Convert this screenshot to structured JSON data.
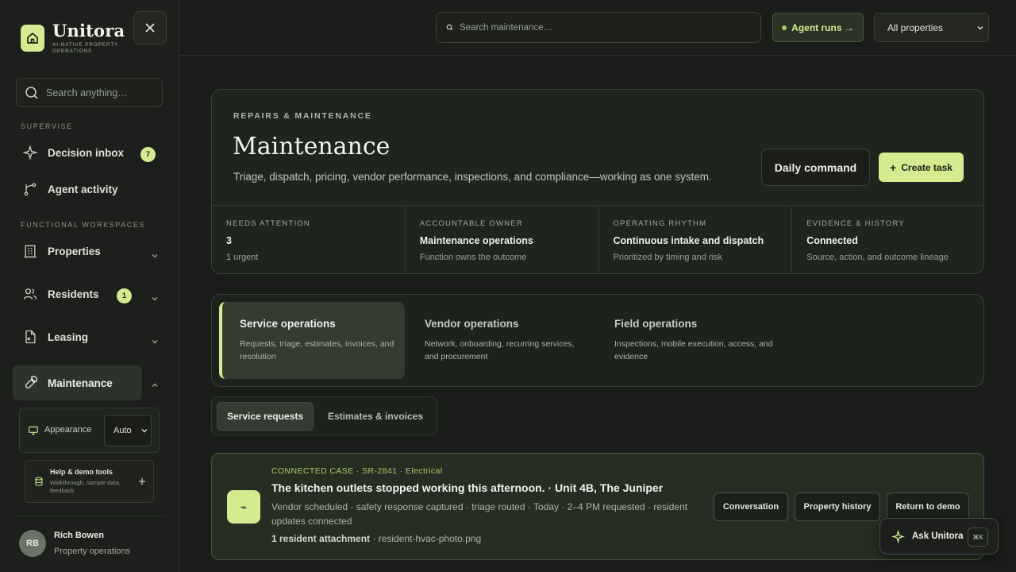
{
  "brand": {
    "name": "Unitora",
    "tagline": "AI-NATIVE PROPERTY OPERATIONS"
  },
  "sidebar": {
    "search_placeholder": "Search anything…",
    "section_supervise": "SUPERVISE",
    "section_workspaces": "FUNCTIONAL WORKSPACES",
    "items": [
      {
        "label": "Decision inbox",
        "badge": "7"
      },
      {
        "label": "Agent activity"
      },
      {
        "label": "Properties"
      },
      {
        "label": "Residents",
        "badge": "1"
      },
      {
        "label": "Leasing"
      },
      {
        "label": "Maintenance"
      }
    ],
    "appearance": {
      "label": "Appearance",
      "value": "Auto"
    },
    "help": {
      "title": "Help & demo tools",
      "subtitle": "Walkthrough, sample data, feedback"
    },
    "user": {
      "initials": "RB",
      "name": "Rich Bowen",
      "role": "Property operations"
    }
  },
  "topbar": {
    "search_placeholder": "Search maintenance…",
    "agent_runs": "Agent runs →",
    "property_filter": "All properties"
  },
  "hero": {
    "eyebrow": "REPAIRS & MAINTENANCE",
    "title": "Maintenance",
    "description": "Triage, dispatch, pricing, vendor performance, inspections, and compliance—working as one system.",
    "daily_command": "Daily command",
    "create_task": "Create task",
    "stats": [
      {
        "label": "NEEDS ATTENTION",
        "value": "3",
        "sub": "1 urgent"
      },
      {
        "label": "ACCOUNTABLE OWNER",
        "value": "Maintenance operations",
        "sub": "Function owns the outcome"
      },
      {
        "label": "OPERATING RHYTHM",
        "value": "Continuous intake and dispatch",
        "sub": "Prioritized by timing and risk"
      },
      {
        "label": "EVIDENCE & HISTORY",
        "value": "Connected",
        "sub": "Source, action, and outcome lineage"
      }
    ]
  },
  "workspaces": [
    {
      "title": "Service operations",
      "desc": "Requests, triage, estimates, invoices, and resolution"
    },
    {
      "title": "Vendor operations",
      "desc": "Network, onboarding, recurring services, and procurement"
    },
    {
      "title": "Field operations",
      "desc": "Inspections, mobile execution, access, and evidence"
    }
  ],
  "subtabs": [
    "Service requests",
    "Estimates & invoices"
  ],
  "case": {
    "meta": "CONNECTED CASE · SR-2841 · Electrical",
    "title": "The kitchen outlets stopped working this afternoon. · Unit 4B, The Juniper",
    "desc": "Vendor scheduled · safety response captured · triage routed · Today · 2–4 PM requested · resident updates connected",
    "attach_label": "1 resident attachment",
    "attach_file": "· resident-hvac-photo.png",
    "buttons": [
      "Conversation",
      "Property history",
      "Return to demo"
    ]
  },
  "ask": {
    "label": "Ask Unitora",
    "shortcut": "⌘K"
  },
  "colors": {
    "accent": "#d4eb8f",
    "background": "#1a1d19",
    "panel": "#20241e"
  }
}
